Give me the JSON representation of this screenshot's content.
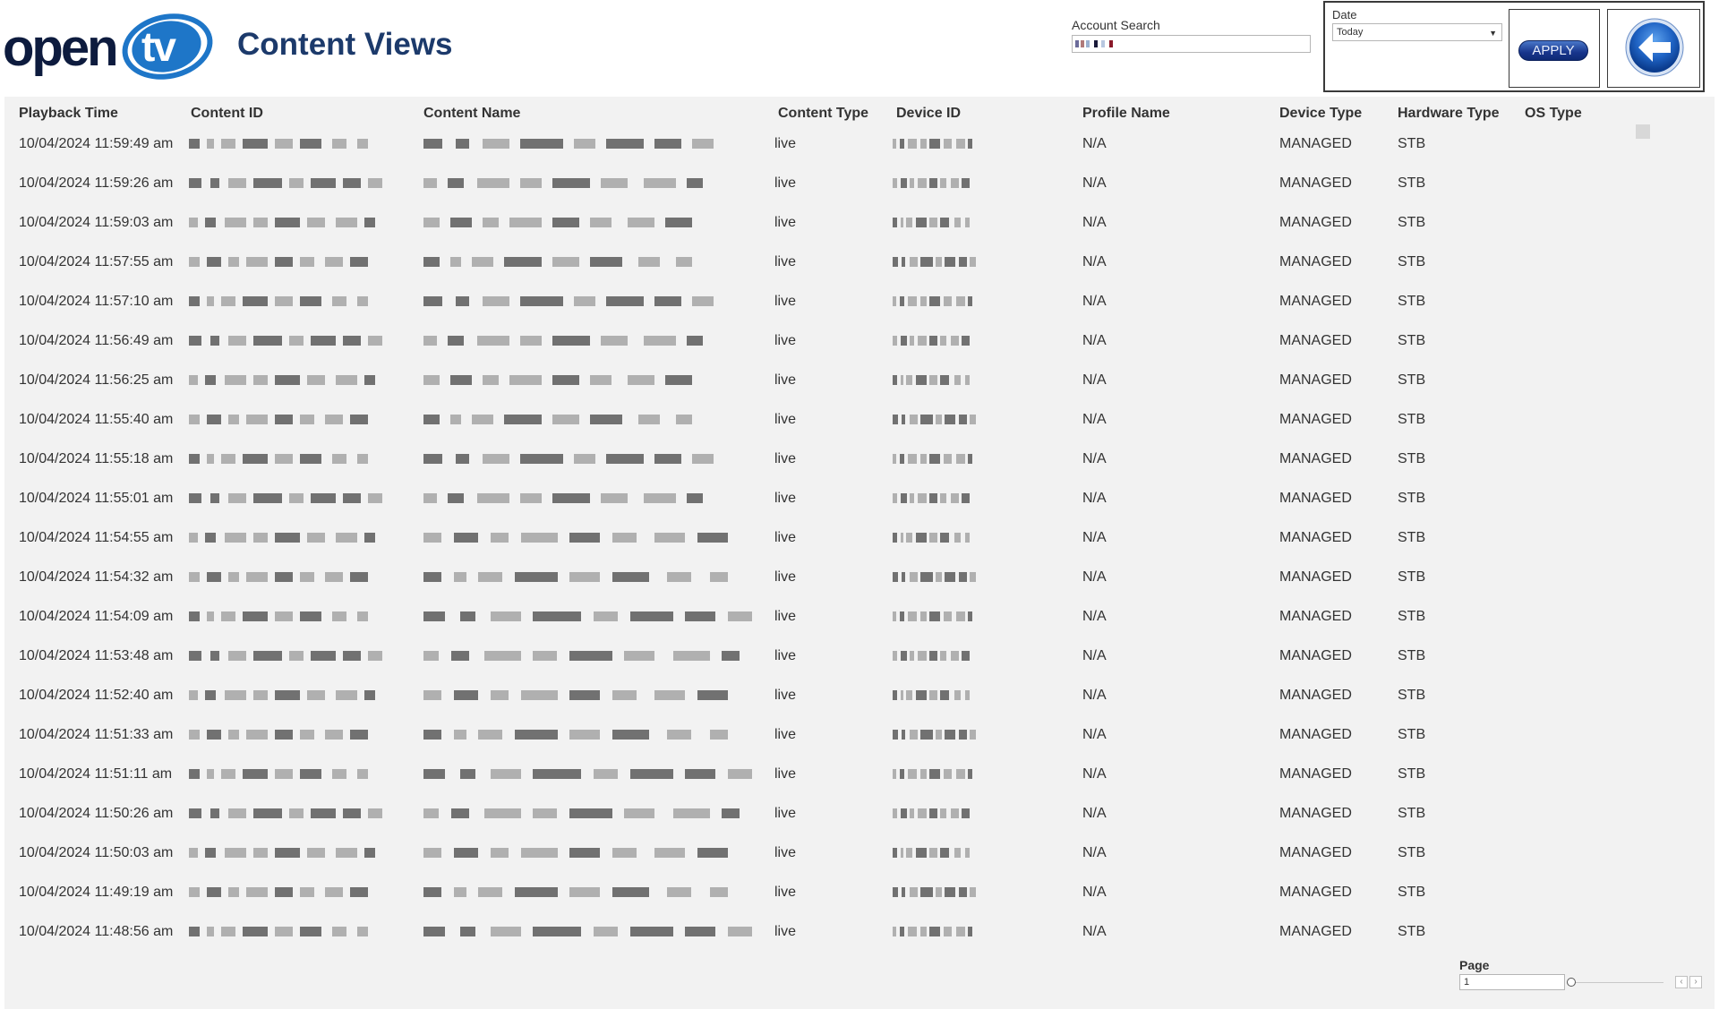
{
  "header": {
    "logo": {
      "word_left": "open",
      "word_right": "tv"
    },
    "title": "Content Views",
    "account_search": {
      "label": "Account Search",
      "value": ""
    },
    "date": {
      "label": "Date",
      "selected": "Today"
    },
    "apply_label": "APPLY",
    "back_icon": "back-arrow-icon"
  },
  "colors": {
    "brand_blue": "#1e76c8",
    "title_navy": "#1c3a6b",
    "panel_bg": "#f2f2f2"
  },
  "table": {
    "columns": [
      "Playback Time",
      "Content ID",
      "Content Name",
      "Content Type",
      "Device ID",
      "Profile Name",
      "Device Type",
      "Hardware Type",
      "OS Type"
    ],
    "rows": [
      {
        "playback_time": "10/04/2024 11:59:49 am",
        "content_type": "live",
        "profile_name": "N/A",
        "device_type": "MANAGED",
        "hardware_type": "STB",
        "os_type": ""
      },
      {
        "playback_time": "10/04/2024 11:59:26 am",
        "content_type": "live",
        "profile_name": "N/A",
        "device_type": "MANAGED",
        "hardware_type": "STB",
        "os_type": ""
      },
      {
        "playback_time": "10/04/2024 11:59:03 am",
        "content_type": "live",
        "profile_name": "N/A",
        "device_type": "MANAGED",
        "hardware_type": "STB",
        "os_type": ""
      },
      {
        "playback_time": "10/04/2024 11:57:55 am",
        "content_type": "live",
        "profile_name": "N/A",
        "device_type": "MANAGED",
        "hardware_type": "STB",
        "os_type": ""
      },
      {
        "playback_time": "10/04/2024 11:57:10 am",
        "content_type": "live",
        "profile_name": "N/A",
        "device_type": "MANAGED",
        "hardware_type": "STB",
        "os_type": ""
      },
      {
        "playback_time": "10/04/2024 11:56:49 am",
        "content_type": "live",
        "profile_name": "N/A",
        "device_type": "MANAGED",
        "hardware_type": "STB",
        "os_type": ""
      },
      {
        "playback_time": "10/04/2024 11:56:25 am",
        "content_type": "live",
        "profile_name": "N/A",
        "device_type": "MANAGED",
        "hardware_type": "STB",
        "os_type": ""
      },
      {
        "playback_time": "10/04/2024 11:55:40 am",
        "content_type": "live",
        "profile_name": "N/A",
        "device_type": "MANAGED",
        "hardware_type": "STB",
        "os_type": ""
      },
      {
        "playback_time": "10/04/2024 11:55:18 am",
        "content_type": "live",
        "profile_name": "N/A",
        "device_type": "MANAGED",
        "hardware_type": "STB",
        "os_type": ""
      },
      {
        "playback_time": "10/04/2024 11:55:01 am",
        "content_type": "live",
        "profile_name": "N/A",
        "device_type": "MANAGED",
        "hardware_type": "STB",
        "os_type": ""
      },
      {
        "playback_time": "10/04/2024 11:54:55 am",
        "content_type": "live",
        "profile_name": "N/A",
        "device_type": "MANAGED",
        "hardware_type": "STB",
        "os_type": ""
      },
      {
        "playback_time": "10/04/2024 11:54:32 am",
        "content_type": "live",
        "profile_name": "N/A",
        "device_type": "MANAGED",
        "hardware_type": "STB",
        "os_type": ""
      },
      {
        "playback_time": "10/04/2024 11:54:09 am",
        "content_type": "live",
        "profile_name": "N/A",
        "device_type": "MANAGED",
        "hardware_type": "STB",
        "os_type": ""
      },
      {
        "playback_time": "10/04/2024 11:53:48 am",
        "content_type": "live",
        "profile_name": "N/A",
        "device_type": "MANAGED",
        "hardware_type": "STB",
        "os_type": ""
      },
      {
        "playback_time": "10/04/2024 11:52:40 am",
        "content_type": "live",
        "profile_name": "N/A",
        "device_type": "MANAGED",
        "hardware_type": "STB",
        "os_type": ""
      },
      {
        "playback_time": "10/04/2024 11:51:33 am",
        "content_type": "live",
        "profile_name": "N/A",
        "device_type": "MANAGED",
        "hardware_type": "STB",
        "os_type": ""
      },
      {
        "playback_time": "10/04/2024 11:51:11 am",
        "content_type": "live",
        "profile_name": "N/A",
        "device_type": "MANAGED",
        "hardware_type": "STB",
        "os_type": ""
      },
      {
        "playback_time": "10/04/2024 11:50:26 am",
        "content_type": "live",
        "profile_name": "N/A",
        "device_type": "MANAGED",
        "hardware_type": "STB",
        "os_type": ""
      },
      {
        "playback_time": "10/04/2024 11:50:03 am",
        "content_type": "live",
        "profile_name": "N/A",
        "device_type": "MANAGED",
        "hardware_type": "STB",
        "os_type": ""
      },
      {
        "playback_time": "10/04/2024 11:49:19 am",
        "content_type": "live",
        "profile_name": "N/A",
        "device_type": "MANAGED",
        "hardware_type": "STB",
        "os_type": ""
      },
      {
        "playback_time": "10/04/2024 11:48:56 am",
        "content_type": "live",
        "profile_name": "N/A",
        "device_type": "MANAGED",
        "hardware_type": "STB",
        "os_type": ""
      }
    ]
  },
  "pager": {
    "label": "Page",
    "value": "1"
  }
}
